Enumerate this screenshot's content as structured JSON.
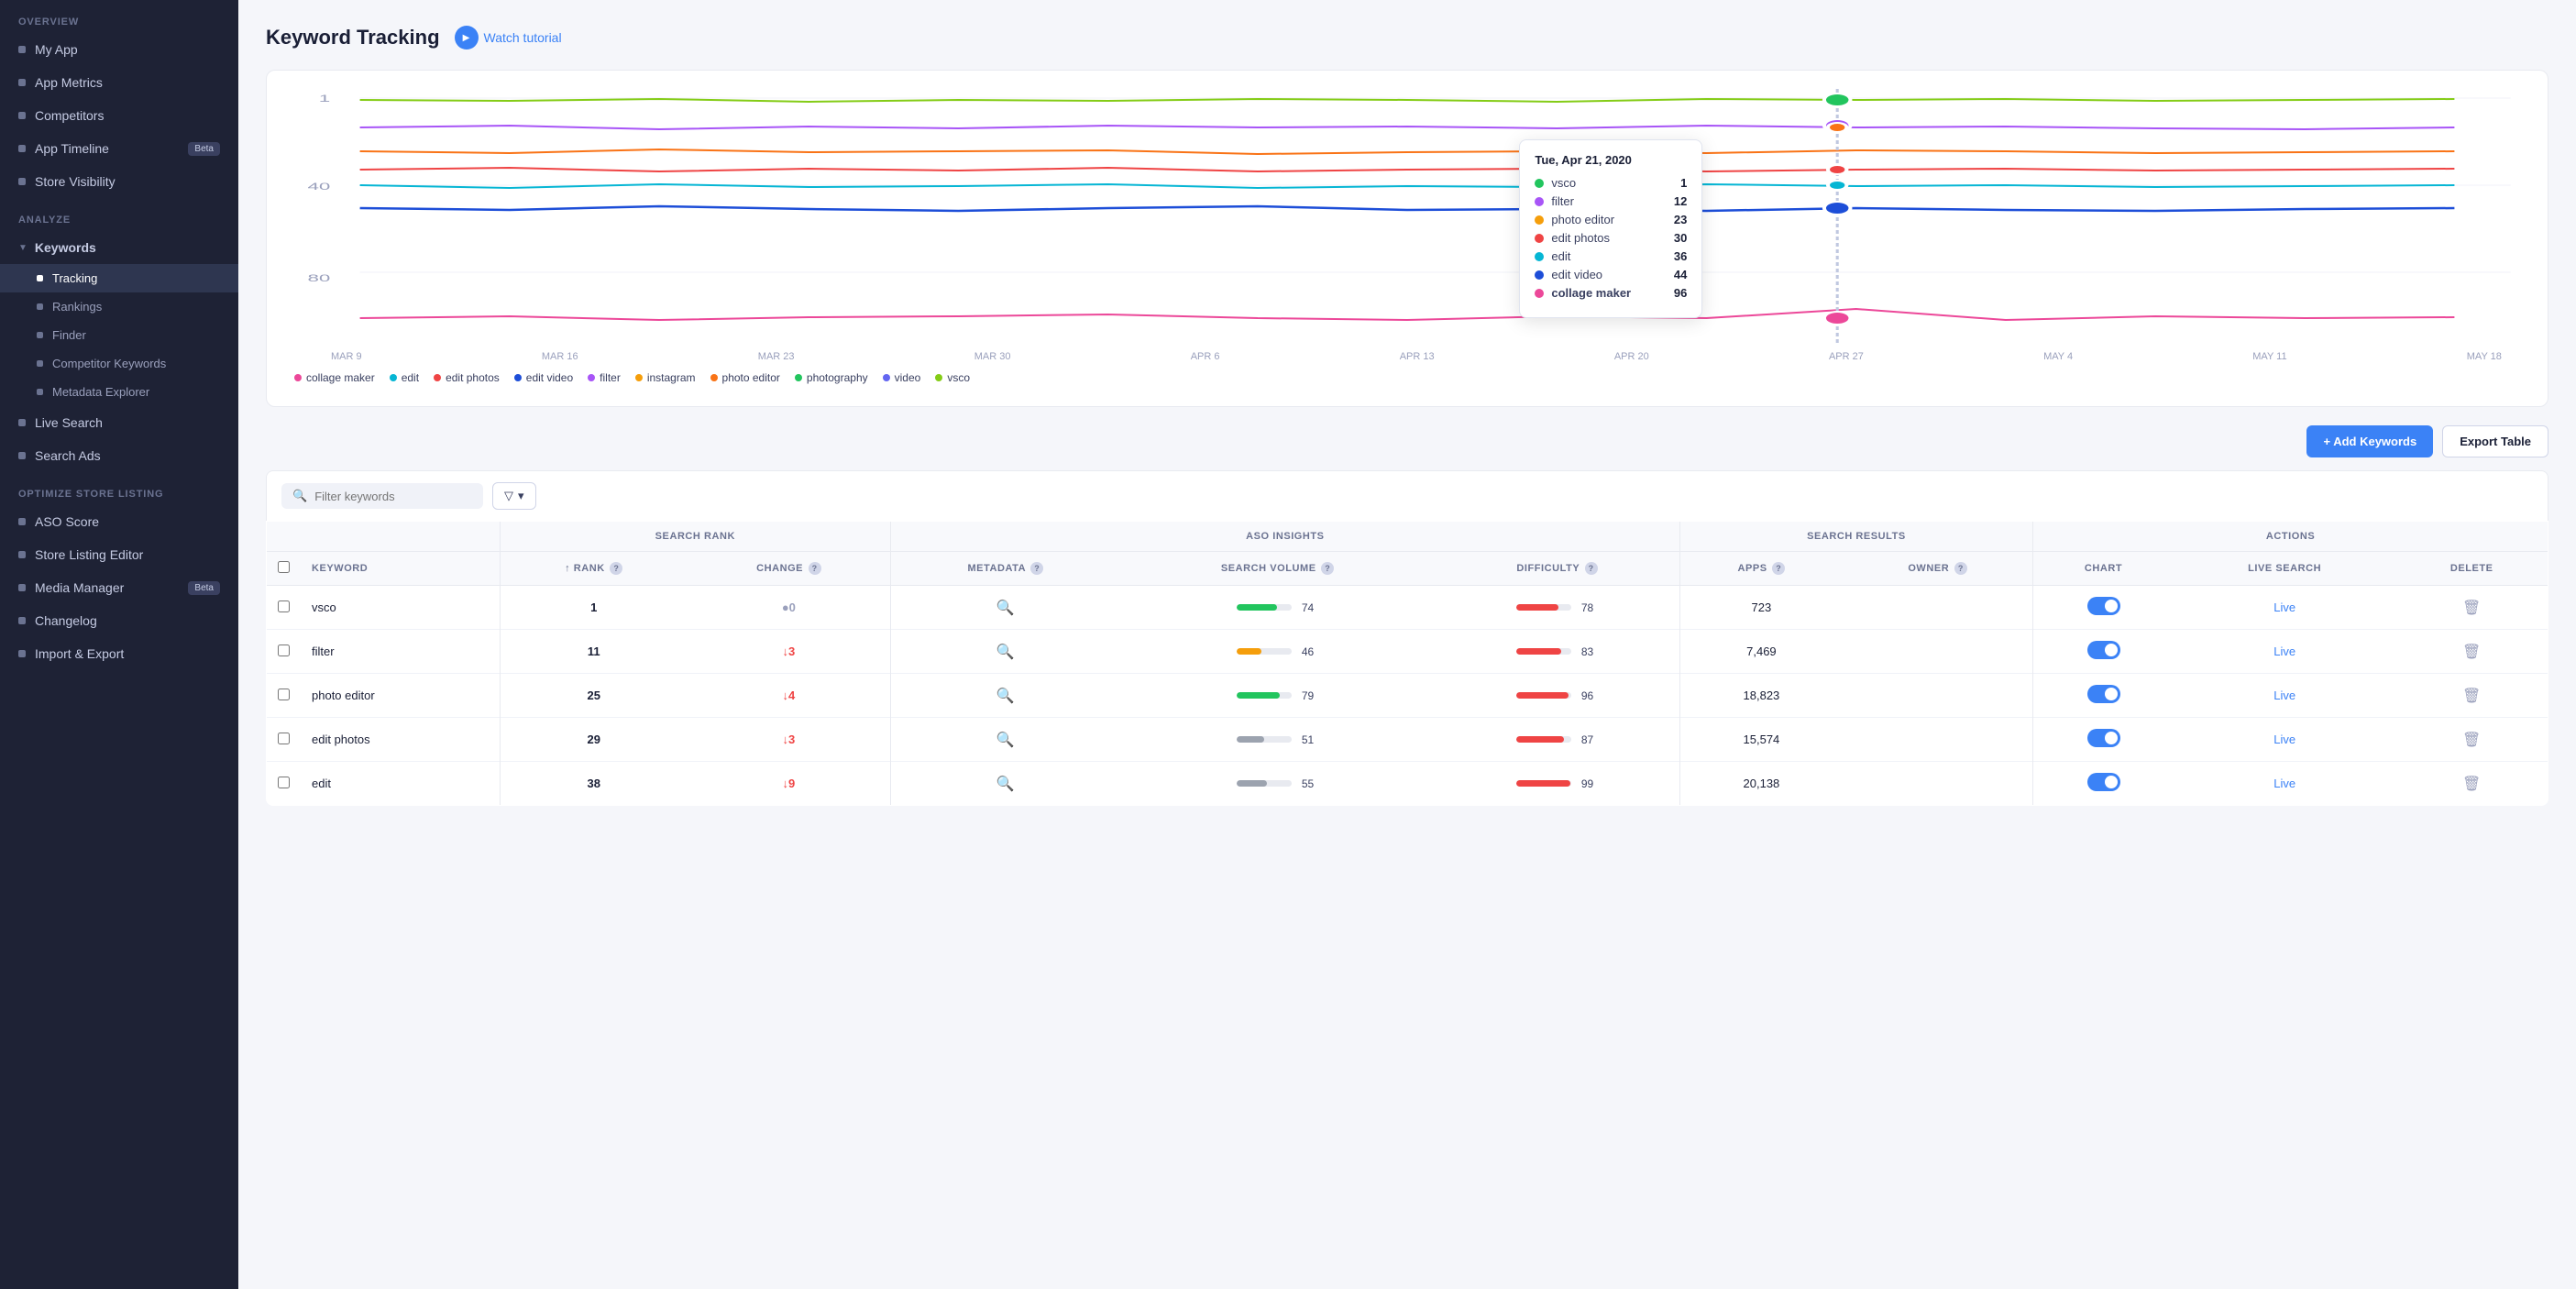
{
  "sidebar": {
    "sections": [
      {
        "label": "OVERVIEW",
        "items": [
          {
            "id": "my-app",
            "label": "My App",
            "indent": false
          },
          {
            "id": "app-metrics",
            "label": "App Metrics",
            "indent": false
          },
          {
            "id": "competitors",
            "label": "Competitors",
            "indent": false
          },
          {
            "id": "app-timeline",
            "label": "App Timeline",
            "indent": false,
            "badge": "Beta"
          },
          {
            "id": "store-visibility",
            "label": "Store Visibility",
            "indent": false
          }
        ]
      },
      {
        "label": "ANALYZE",
        "items": [
          {
            "id": "keywords",
            "label": "Keywords",
            "group": true,
            "expanded": true,
            "children": [
              {
                "id": "tracking",
                "label": "Tracking",
                "active": true
              },
              {
                "id": "rankings",
                "label": "Rankings"
              },
              {
                "id": "finder",
                "label": "Finder"
              },
              {
                "id": "competitor-keywords",
                "label": "Competitor Keywords"
              },
              {
                "id": "metadata-explorer",
                "label": "Metadata Explorer"
              }
            ]
          },
          {
            "id": "live-search",
            "label": "Live Search",
            "indent": false
          },
          {
            "id": "search-ads",
            "label": "Search Ads",
            "indent": false
          }
        ]
      },
      {
        "label": "OPTIMIZE STORE LISTING",
        "items": [
          {
            "id": "aso-score",
            "label": "ASO Score",
            "indent": false
          },
          {
            "id": "store-listing-editor",
            "label": "Store Listing Editor",
            "indent": false
          },
          {
            "id": "media-manager",
            "label": "Media Manager",
            "indent": false,
            "badge": "Beta"
          },
          {
            "id": "changelog",
            "label": "Changelog",
            "indent": false
          },
          {
            "id": "import-export",
            "label": "Import & Export",
            "indent": false
          }
        ]
      }
    ]
  },
  "header": {
    "title": "Keyword Tracking",
    "tutorial_label": "Watch tutorial"
  },
  "chart": {
    "tooltip": {
      "date": "Tue, Apr 21, 2020",
      "items": [
        {
          "label": "vsco",
          "value": "1",
          "color": "#22c55e"
        },
        {
          "label": "filter",
          "value": "12",
          "color": "#a855f7"
        },
        {
          "label": "photo editor",
          "value": "23",
          "color": "#f59e0b"
        },
        {
          "label": "edit photos",
          "value": "30",
          "color": "#ef4444"
        },
        {
          "label": "edit",
          "value": "36",
          "color": "#06b6d4"
        },
        {
          "label": "edit video",
          "value": "44",
          "color": "#1d4ed8"
        },
        {
          "label": "collage maker",
          "value": "96",
          "color": "#ec4899",
          "bold": true
        }
      ]
    },
    "x_labels": [
      "MAR 9",
      "MAR 16",
      "MAR 23",
      "MAR 30",
      "APR 6",
      "APR 13",
      "APR 20",
      "APR 27",
      "MAY 4",
      "MAY 11",
      "MAY 18"
    ],
    "y_labels": [
      "1",
      "40",
      "80"
    ],
    "legend": [
      {
        "label": "collage maker",
        "color": "#ec4899"
      },
      {
        "label": "edit",
        "color": "#06b6d4"
      },
      {
        "label": "edit photos",
        "color": "#ef4444"
      },
      {
        "label": "edit video",
        "color": "#1d4ed8"
      },
      {
        "label": "filter",
        "color": "#a855f7"
      },
      {
        "label": "instagram",
        "color": "#f59e0b"
      },
      {
        "label": "photo editor",
        "color": "#f97316"
      },
      {
        "label": "photography",
        "color": "#22c55e"
      },
      {
        "label": "video",
        "color": "#6366f1"
      },
      {
        "label": "vsco",
        "color": "#84cc16"
      }
    ]
  },
  "toolbar": {
    "add_label": "+ Add Keywords",
    "export_label": "Export Table",
    "search_placeholder": "Filter keywords"
  },
  "table": {
    "group_headers": [
      {
        "label": "SEARCH RANK",
        "span": 2
      },
      {
        "label": "ASO INSIGHTS",
        "span": 3
      },
      {
        "label": "SEARCH RESULTS",
        "span": 2
      },
      {
        "label": "ACTIONS",
        "span": 3
      }
    ],
    "col_headers": [
      {
        "label": "KEYWORD",
        "align": "left"
      },
      {
        "label": "↑ RANK",
        "help": true
      },
      {
        "label": "CHANGE",
        "help": true
      },
      {
        "label": "METADATA",
        "help": true
      },
      {
        "label": "SEARCH VOLUME",
        "help": true
      },
      {
        "label": "DIFFICULTY",
        "help": true
      },
      {
        "label": "APPS",
        "help": true
      },
      {
        "label": "OWNER",
        "help": true
      },
      {
        "label": "CHART"
      },
      {
        "label": "LIVE SEARCH"
      },
      {
        "label": "DELETE"
      }
    ],
    "rows": [
      {
        "keyword": "vsco",
        "rank": "1",
        "change": "0",
        "change_dir": "neutral",
        "metadata": true,
        "search_volume": 74,
        "search_volume_color": "#22c55e",
        "difficulty": 78,
        "difficulty_color": "#ef4444",
        "apps": "723",
        "owner": "",
        "chart_on": true,
        "live": "Live"
      },
      {
        "keyword": "filter",
        "rank": "11",
        "change": "3",
        "change_dir": "down",
        "metadata": true,
        "search_volume": 46,
        "search_volume_color": "#f59e0b",
        "difficulty": 83,
        "difficulty_color": "#ef4444",
        "apps": "7,469",
        "owner": "",
        "chart_on": true,
        "live": "Live"
      },
      {
        "keyword": "photo editor",
        "rank": "25",
        "change": "4",
        "change_dir": "down",
        "metadata": true,
        "search_volume": 79,
        "search_volume_color": "#22c55e",
        "difficulty": 96,
        "difficulty_color": "#ef4444",
        "apps": "18,823",
        "owner": "",
        "chart_on": true,
        "live": "Live"
      },
      {
        "keyword": "edit photos",
        "rank": "29",
        "change": "3",
        "change_dir": "down",
        "metadata": true,
        "search_volume": 51,
        "search_volume_color": "#9ca3af",
        "difficulty": 87,
        "difficulty_color": "#ef4444",
        "apps": "15,574",
        "owner": "",
        "chart_on": true,
        "live": "Live"
      },
      {
        "keyword": "edit",
        "rank": "38",
        "change": "9",
        "change_dir": "down",
        "metadata": true,
        "search_volume": 55,
        "search_volume_color": "#9ca3af",
        "difficulty": 99,
        "difficulty_color": "#ef4444",
        "apps": "20,138",
        "owner": "",
        "chart_on": true,
        "live": "Live"
      }
    ]
  }
}
